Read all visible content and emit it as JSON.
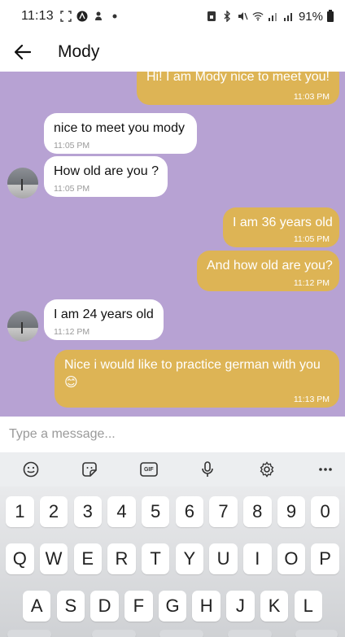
{
  "status_bar": {
    "time": "11:13",
    "battery": "91%"
  },
  "header": {
    "title": "Mody"
  },
  "messages": [
    {
      "dir": "out",
      "text": "Hi! I am Mody nice to meet you!",
      "time": "11:03 PM"
    },
    {
      "dir": "in",
      "text": "nice to meet you mody",
      "time": "11:05 PM"
    },
    {
      "dir": "in",
      "text": "How old are you ?",
      "time": "11:05 PM"
    },
    {
      "dir": "out",
      "text": "I am 36 years old",
      "time": "11:05 PM"
    },
    {
      "dir": "out",
      "text": "And how old are you?",
      "time": "11:12 PM"
    },
    {
      "dir": "in",
      "text": "I am 24 years old",
      "time": "11:12 PM"
    },
    {
      "dir": "out",
      "text": "Nice i would like to practice german with you",
      "emoji": "😊",
      "time": "11:13 PM"
    }
  ],
  "composer": {
    "placeholder": "Type a message..."
  },
  "keyboard": {
    "toolbar": [
      "emoji-icon",
      "sticker-icon",
      "gif-icon",
      "microphone-icon",
      "settings-icon",
      "more-icon"
    ],
    "gif_label": "GIF",
    "rows": [
      [
        "1",
        "2",
        "3",
        "4",
        "5",
        "6",
        "7",
        "8",
        "9",
        "0"
      ],
      [
        "Q",
        "W",
        "E",
        "R",
        "T",
        "Y",
        "U",
        "I",
        "O",
        "P"
      ],
      [
        "A",
        "S",
        "D",
        "F",
        "G",
        "H",
        "J",
        "K",
        "L"
      ]
    ]
  },
  "colors": {
    "chat_background": "#b7a2d3",
    "outgoing_bubble": "#ddb455",
    "incoming_bubble": "#ffffff"
  }
}
